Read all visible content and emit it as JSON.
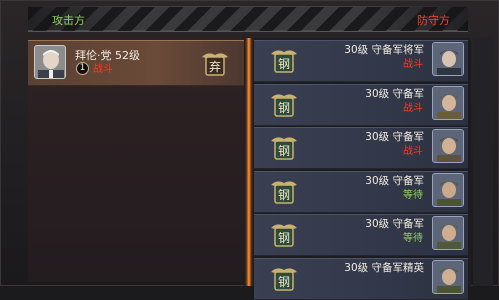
{
  "header": {
    "attack_label": "攻击方",
    "defense_label": "防守方"
  },
  "attacker": {
    "name_line": "拜伦·党  52级",
    "rank": "1",
    "status": "战斗",
    "badge_icon": "quit-badge-icon",
    "badge_char": "弃"
  },
  "defenders": [
    {
      "label": "30级   守备军将军",
      "status": "战斗",
      "status_type": "fight"
    },
    {
      "label": "30级   守备军",
      "status": "战斗",
      "status_type": "fight"
    },
    {
      "label": "30级   守备军",
      "status": "战斗",
      "status_type": "fight"
    },
    {
      "label": "30级   守备军",
      "status": "等待",
      "status_type": "wait"
    },
    {
      "label": "30级   守备军",
      "status": "等待",
      "status_type": "wait"
    },
    {
      "label": "30级   守备军精英",
      "status": "",
      "status_type": "wait"
    }
  ],
  "defender_badge_char": "钢",
  "colors": {
    "fight": "#ff3a1f",
    "wait": "#8cd95a",
    "divider_glow": "#f3a23a"
  }
}
